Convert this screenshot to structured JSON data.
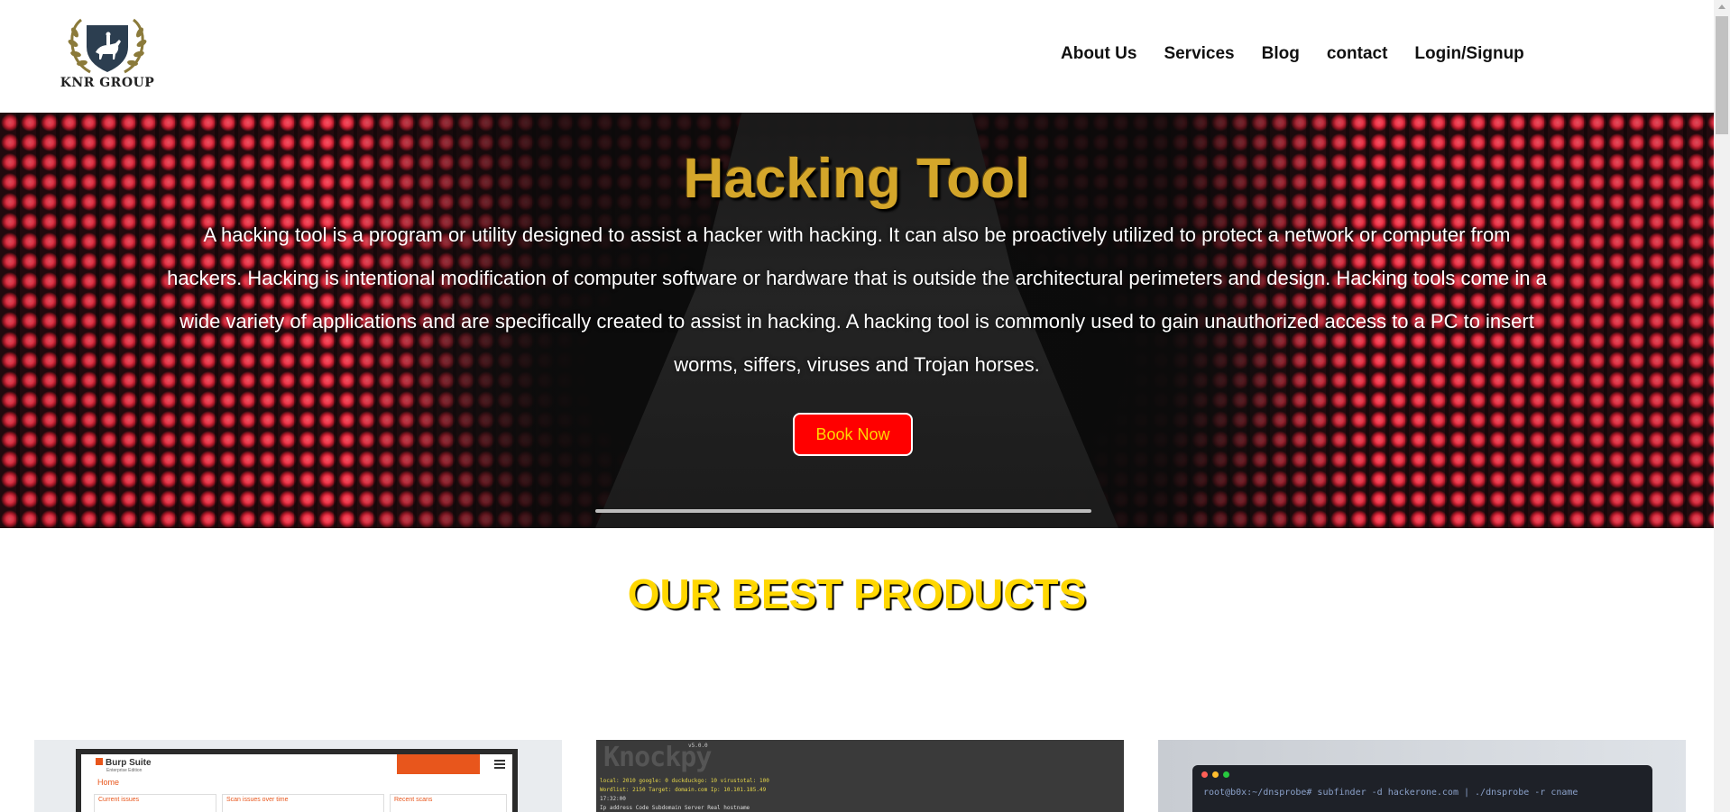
{
  "brand": {
    "name": "KNR GROUP"
  },
  "nav": {
    "items": [
      {
        "label": "About Us"
      },
      {
        "label": "Services"
      },
      {
        "label": "Blog"
      },
      {
        "label": "contact"
      },
      {
        "label": "Login/Signup"
      }
    ]
  },
  "hero": {
    "title": "Hacking Tool",
    "description": "A hacking tool is a program or utility designed to assist a hacker with hacking. It can also be proactively utilized to protect a network or computer from hackers. Hacking is intentional modification of computer software or hardware that is outside the architectural perimeters and design. Hacking tools come in a wide variety of applications and are specifically created to assist in hacking. A hacking tool is commonly used to gain unauthorized access to a PC to insert worms, siffers, viruses and Trojan horses.",
    "button_label": "Book Now"
  },
  "products": {
    "title": "OUR BEST PRODUCTS",
    "cards": [
      {
        "app_name": "Burp Suite",
        "app_subtitle": "Enterprise Edition",
        "page": "Home",
        "panels": [
          "Current issues",
          "Scan issues over time",
          "Recent scans"
        ]
      },
      {
        "logo": "Knockpy",
        "version": "v5.0.0",
        "stats": "local: 2010  google: 0  duckduckgo: 10  virustotal: 100",
        "wordlist": "Wordlist: 2150  Target: domain.com  Ip: 10.101.185.49",
        "time": "17:32:00",
        "columns": "Ip address     Code Subdomain                    Server                   Real hostname"
      },
      {
        "command": "root@b0x:~/dnsprobe# subfinder -d hackerone.com | ./dnsprobe -r cname"
      }
    ]
  },
  "colors": {
    "title_gold": "#d4a62a",
    "products_title": "#ffd700",
    "button_bg": "#ff0000",
    "button_text": "#ffd700",
    "burp_orange": "#e8561c"
  }
}
